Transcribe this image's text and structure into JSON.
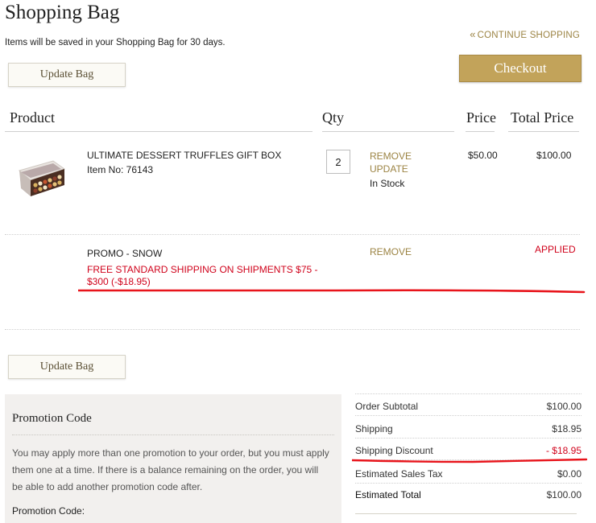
{
  "header": {
    "title": "Shopping Bag",
    "saved_note": "Items will be saved in your Shopping Bag for 30 days.",
    "continue_shopping": "CONTINUE SHOPPING"
  },
  "buttons": {
    "update_bag": "Update Bag",
    "checkout": "Checkout"
  },
  "table": {
    "headers": {
      "product": "Product",
      "qty": "Qty",
      "price": "Price",
      "total_price": "Total Price"
    },
    "item": {
      "name": "ULTIMATE DESSERT TRUFFLES GIFT BOX",
      "item_no": "Item No: 76143",
      "qty": "2",
      "remove": "REMOVE",
      "update": "UPDATE",
      "stock": "In Stock",
      "price": "$50.00",
      "total": "$100.00"
    },
    "promo": {
      "name": "PROMO - SNOW",
      "description": "FREE STANDARD SHIPPING ON SHIPMENTS $75 - $300 (-$18.95)",
      "remove": "REMOVE",
      "status": "APPLIED"
    }
  },
  "promotion_panel": {
    "title": "Promotion Code",
    "help": "You may apply more than one promotion to your order, but you must apply them one at a time. If there is a balance remaining on the order, you will be able to add another promotion code after.",
    "label": "Promotion Code:"
  },
  "summary": {
    "subtotal_label": "Order Subtotal",
    "subtotal_value": "$100.00",
    "shipping_label": "Shipping",
    "shipping_value": "$18.95",
    "discount_label": "Shipping Discount",
    "discount_value": "- $18.95",
    "tax_label": "Estimated Sales Tax",
    "tax_value": "$0.00",
    "total_label": "Estimated Total",
    "total_value": "$100.00"
  },
  "colors": {
    "accent_gold": "#c2a35a",
    "link_gold": "#9c8444",
    "promo_red": "#d0021b",
    "panel_bg": "#f2f0ee"
  },
  "icons": {
    "continue": "double-chevron-left-icon",
    "product_image": "truffle-box-image"
  }
}
